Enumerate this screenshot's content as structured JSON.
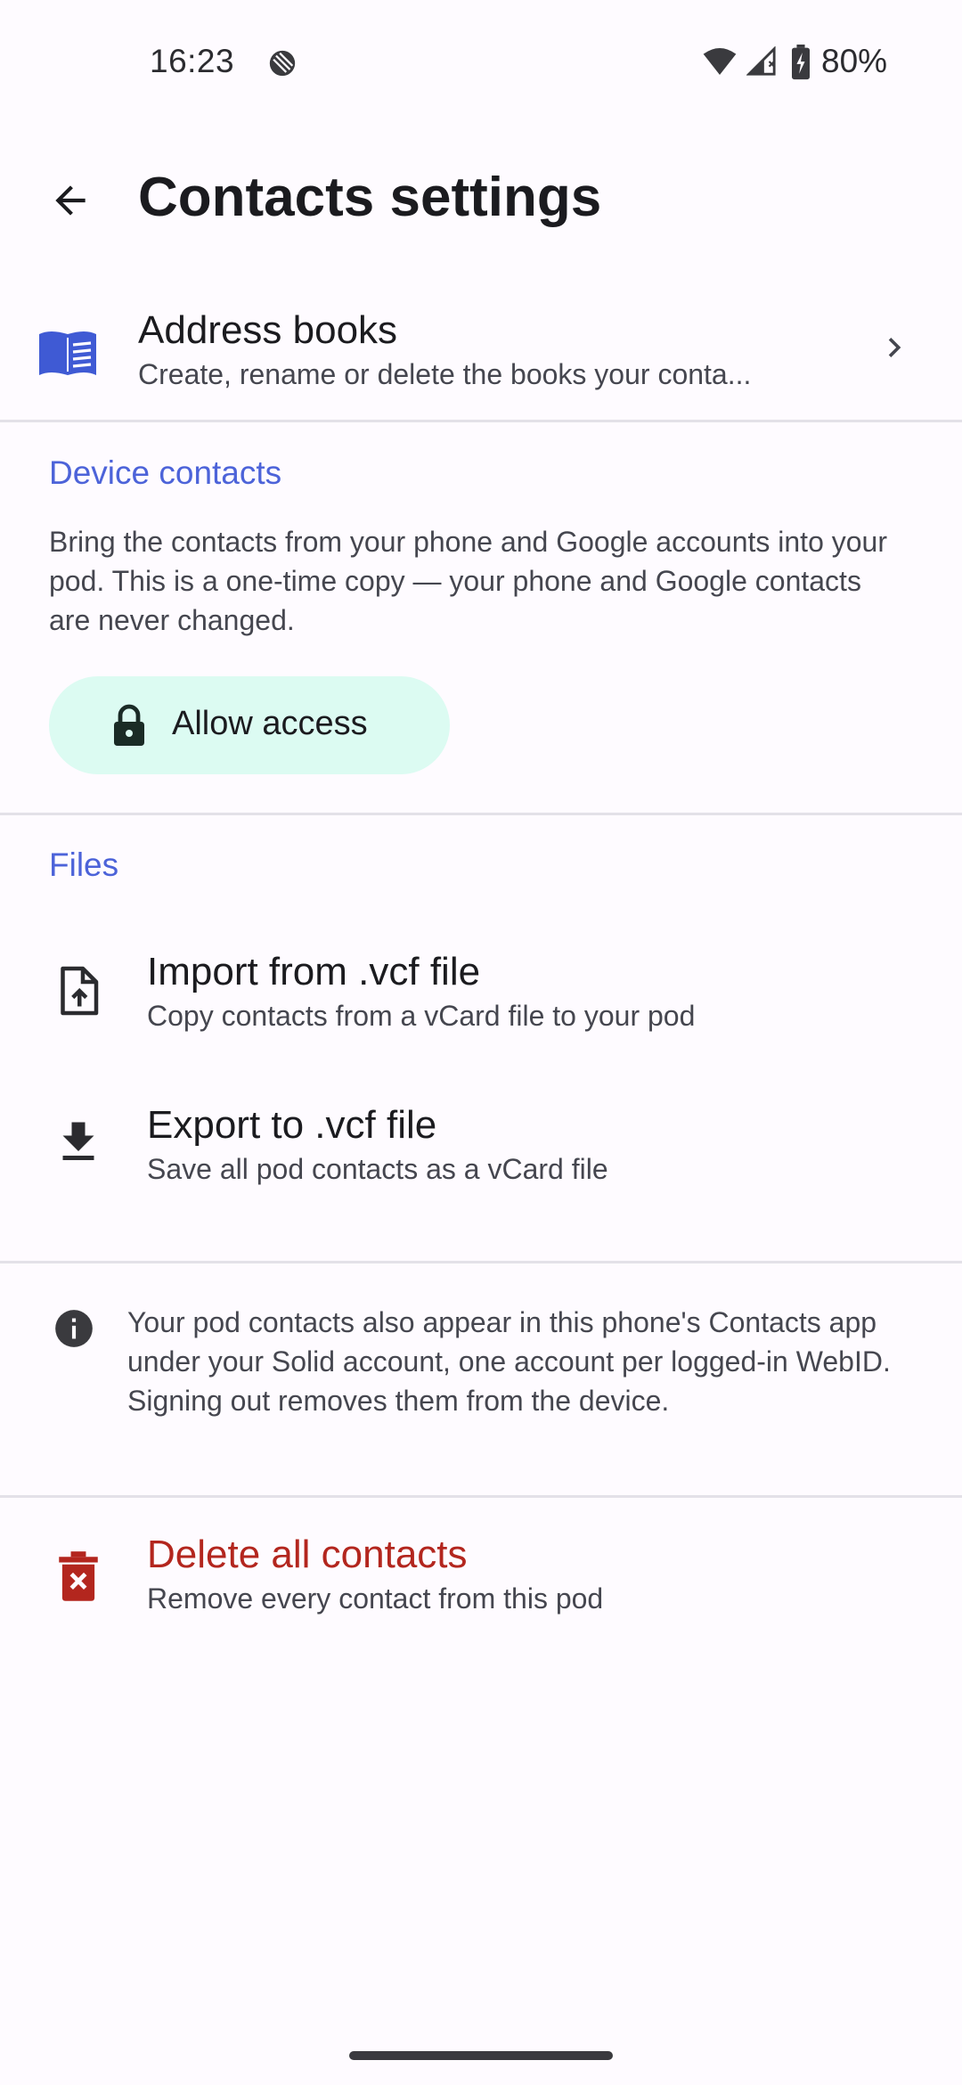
{
  "status_bar": {
    "time": "16:23",
    "battery": "80%",
    "icons": [
      "dnd-icon",
      "wifi-icon",
      "signal-icon",
      "battery-icon"
    ]
  },
  "toolbar": {
    "title": "Contacts settings",
    "back_icon": "arrow-back-icon"
  },
  "address_books": {
    "title": "Address books",
    "subtitle": "Create, rename or delete the books your conta...",
    "icon": "book-icon"
  },
  "device_contacts": {
    "header": "Device contacts",
    "description": "Bring the contacts from your phone and Google accounts into your pod. This is a one-time copy — your phone and Google contacts are never changed.",
    "allow_button": "Allow access"
  },
  "files": {
    "header": "Files",
    "items": [
      {
        "title": "Import from .vcf file",
        "subtitle": "Copy contacts from a vCard file to your pod",
        "icon": "file-upload-icon"
      },
      {
        "title": "Export to .vcf file",
        "subtitle": "Save all pod contacts as a vCard file",
        "icon": "download-icon"
      }
    ]
  },
  "info": {
    "text": "Your pod contacts also appear in this phone's Contacts app under your Solid account, one account per logged-in WebID. Signing out removes them from the device."
  },
  "delete": {
    "title": "Delete all contacts",
    "subtitle": "Remove every contact from this pod",
    "icon": "delete-icon"
  },
  "colors": {
    "accent": "#4c63d9",
    "danger": "#b3261e",
    "button_bg": "#dcfbf2",
    "background": "#fefbff"
  }
}
